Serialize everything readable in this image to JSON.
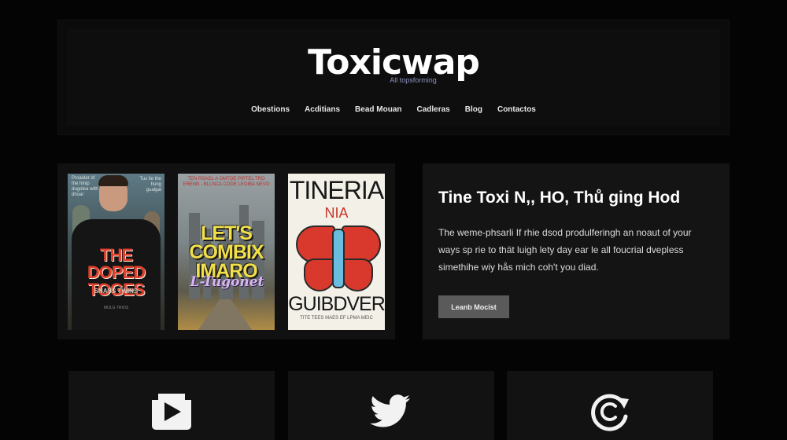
{
  "header": {
    "logo": "Toxicwap",
    "tagline": "All topsforming",
    "nav": [
      "Obestions",
      "Acditians",
      "Bead Mouan",
      "Cadleras",
      "Blog",
      "Contactos"
    ]
  },
  "posters": [
    {
      "blurb_left": "Proaoler of the hinip dugolea with dhoar",
      "blurb_right": "Tus lie the hung gualgal",
      "title": "THE DOPED TOGES",
      "subtitle": "SNASS TWINS",
      "fine_print": "MOLG TRIOS",
      "accent": "#e2402d"
    },
    {
      "blurb": "TEN RSADL A OMTOE PIPTEL TRO ERENN - BLLNCA CODE LEOIBA NEVO",
      "title": "LET'S COMBIX IMARO",
      "script": "L-Tugonet",
      "accent": "#f1e04a"
    },
    {
      "title_top": "TINERIA",
      "title_mid": "NIA",
      "title_bottom": "GUIBDVER",
      "fine_print": "TITE TEES MAES EF LPMA MEIC",
      "accent": "#d9392c"
    }
  ],
  "feature": {
    "title": "Tine Toxi N,, HO, Thů ging Hod",
    "lines": [
      "The weme-phsarli If rhie dsod produlferingh an noaut of your",
      "ways sp rie to thät luigh lety day ear le all foucrial dvepless",
      "simethihe wiy hås mich coh't you diad."
    ],
    "button": "Leanb Mocist"
  },
  "social": [
    {
      "icon": "video-play-icon"
    },
    {
      "icon": "twitter-bird-icon"
    },
    {
      "icon": "refresh-c-icon"
    }
  ],
  "colors": {
    "background": "#040404",
    "panel": "#141414",
    "button": "#5a5a5a",
    "tagline": "#8a93c0"
  }
}
